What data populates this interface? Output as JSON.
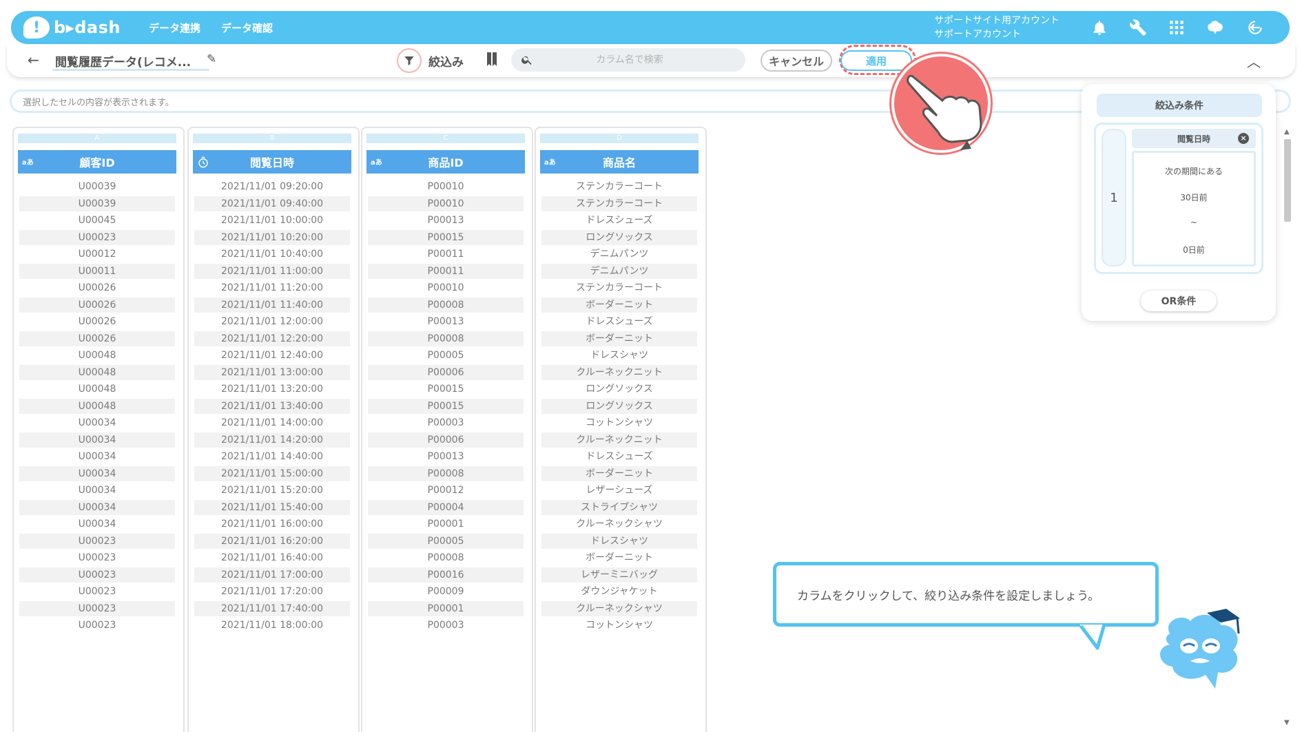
{
  "header": {
    "logo_mark": "!",
    "logo_text": "b▸dash",
    "nav": [
      "データ連携",
      "データ確認"
    ],
    "account_line1": "サポートサイト用アカウント",
    "account_line2": "サポートアカウント"
  },
  "toolbar": {
    "back": "←",
    "title": "閲覧履歴データ(レコメ...",
    "filter_label": "絞込み",
    "search_placeholder": "カラム名で検索",
    "cancel_label": "キャンセル",
    "apply_label": "適用"
  },
  "cell_bar": {
    "placeholder": "選択したセルの内容が表示されます。"
  },
  "table": {
    "columns": [
      {
        "letter": "A",
        "type": "aあ",
        "header": "顧客ID"
      },
      {
        "letter": "B",
        "type": "timer",
        "header": "閲覧日時"
      },
      {
        "letter": "C",
        "type": "aあ",
        "header": "商品ID"
      },
      {
        "letter": "D",
        "type": "aあ",
        "header": "商品名"
      }
    ],
    "rows": [
      [
        "U00039",
        "2021/11/01 09:20:00",
        "P00010",
        "ステンカラーコート"
      ],
      [
        "U00039",
        "2021/11/01 09:40:00",
        "P00010",
        "ステンカラーコート"
      ],
      [
        "U00045",
        "2021/11/01 10:00:00",
        "P00013",
        "ドレスシューズ"
      ],
      [
        "U00023",
        "2021/11/01 10:20:00",
        "P00015",
        "ロングソックス"
      ],
      [
        "U00012",
        "2021/11/01 10:40:00",
        "P00011",
        "デニムパンツ"
      ],
      [
        "U00011",
        "2021/11/01 11:00:00",
        "P00011",
        "デニムパンツ"
      ],
      [
        "U00026",
        "2021/11/01 11:20:00",
        "P00010",
        "ステンカラーコート"
      ],
      [
        "U00026",
        "2021/11/01 11:40:00",
        "P00008",
        "ボーダーニット"
      ],
      [
        "U00026",
        "2021/11/01 12:00:00",
        "P00013",
        "ドレスシューズ"
      ],
      [
        "U00026",
        "2021/11/01 12:20:00",
        "P00008",
        "ボーダーニット"
      ],
      [
        "U00048",
        "2021/11/01 12:40:00",
        "P00005",
        "ドレスシャツ"
      ],
      [
        "U00048",
        "2021/11/01 13:00:00",
        "P00006",
        "クルーネックニット"
      ],
      [
        "U00048",
        "2021/11/01 13:20:00",
        "P00015",
        "ロングソックス"
      ],
      [
        "U00048",
        "2021/11/01 13:40:00",
        "P00015",
        "ロングソックス"
      ],
      [
        "U00034",
        "2021/11/01 14:00:00",
        "P00003",
        "コットンシャツ"
      ],
      [
        "U00034",
        "2021/11/01 14:20:00",
        "P00006",
        "クルーネックニット"
      ],
      [
        "U00034",
        "2021/11/01 14:40:00",
        "P00013",
        "ドレスシューズ"
      ],
      [
        "U00034",
        "2021/11/01 15:00:00",
        "P00008",
        "ボーダーニット"
      ],
      [
        "U00034",
        "2021/11/01 15:20:00",
        "P00012",
        "レザーシューズ"
      ],
      [
        "U00034",
        "2021/11/01 15:40:00",
        "P00004",
        "ストライプシャツ"
      ],
      [
        "U00034",
        "2021/11/01 16:00:00",
        "P00001",
        "クルーネックシャツ"
      ],
      [
        "U00023",
        "2021/11/01 16:20:00",
        "P00005",
        "ドレスシャツ"
      ],
      [
        "U00023",
        "2021/11/01 16:40:00",
        "P00008",
        "ボーダーニット"
      ],
      [
        "U00023",
        "2021/11/01 17:00:00",
        "P00016",
        "レザーミニバッグ"
      ],
      [
        "U00023",
        "2021/11/01 17:20:00",
        "P00009",
        "ダウンジャケット"
      ],
      [
        "U00023",
        "2021/11/01 17:40:00",
        "P00001",
        "クルーネックシャツ"
      ],
      [
        "U00023",
        "2021/11/01 18:00:00",
        "P00003",
        "コットンシャツ"
      ]
    ]
  },
  "filter_panel": {
    "title": "絞込み条件",
    "group_number": "1",
    "field": "閲覧日時",
    "condition": "次の期間にある",
    "from": "30日前",
    "separator": "~",
    "to": "0日前",
    "or_button": "OR条件"
  },
  "tooltip": {
    "text": "カラムをクリックして、絞り込み条件を設定しましょう。"
  },
  "colors": {
    "brand": "#53c3f1",
    "column_header": "#53a6e9",
    "highlight": "#f27474"
  }
}
